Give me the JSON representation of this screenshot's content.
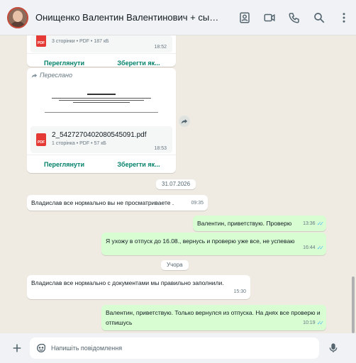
{
  "header": {
    "title": "Онищенко Валентин Валентинович + сын Онищенко Я..."
  },
  "icons": {
    "profile": "contact-card-icon",
    "video": "video-call-icon",
    "phone": "phone-icon",
    "search": "search-icon",
    "menu": "more-vertical-icon",
    "forward": "forward-icon",
    "pdf": "pdf-icon",
    "plus": "plus-icon",
    "sticker": "sticker-icon",
    "mic": "mic-icon"
  },
  "colors": {
    "accent": "#008069",
    "outgoing_bubble": "#d9fdd3",
    "incoming_bubble": "#ffffff",
    "chat_background": "#efeae2",
    "read_ticks": "#53bdeb",
    "pdf_red": "#e53935"
  },
  "doc1": {
    "meta": "3 сторінки • PDF • 187 кБ",
    "time": "18:52",
    "view_label": "Переглянути",
    "save_label": "Зберегти як..."
  },
  "doc2": {
    "forwarded_label": "Переслано",
    "filename": "2_5427270402080545091.pdf",
    "meta": "1 сторінка • PDF • 57 кБ",
    "time": "18:53",
    "view_label": "Переглянути",
    "save_label": "Зберегти як..."
  },
  "date_separators": [
    "31.07.2026",
    "Учора"
  ],
  "messages": [
    {
      "text": "Владислав  все нормально  вы не просматриваете .",
      "time": "09:35"
    },
    {
      "text": "Валентин, приветствую. Проверю",
      "time": "13:36"
    },
    {
      "text": "Я ухожу в отпуск до 16.08., вернусь и проверю уже все, не успеваю",
      "time": "16:44"
    },
    {
      "text": "Владислав  все нормально  с документами  мы правильно  заполнили.",
      "time": "15:30"
    },
    {
      "text": "Валентин, приветствую. Только вернулся из отпуска. На днях все проверю и отпишусь",
      "time": "10:19"
    }
  ],
  "composer": {
    "placeholder": "Напишіть повідомлення"
  }
}
